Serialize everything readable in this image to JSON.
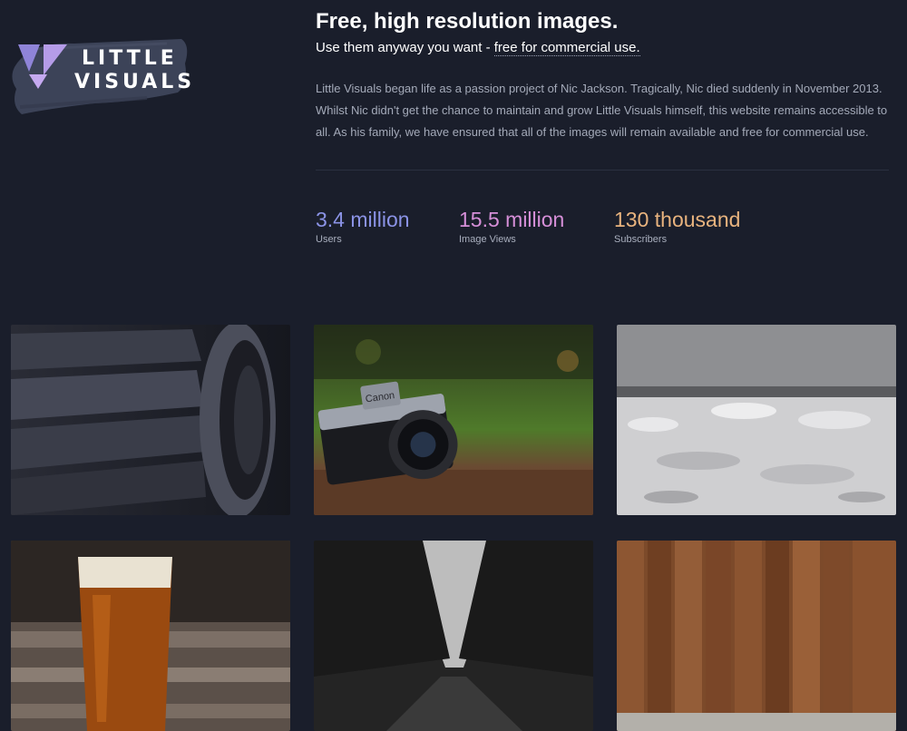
{
  "brand": {
    "line1": "LITTLE",
    "line2": "VISUALS"
  },
  "hero": {
    "headline": "Free, high resolution images.",
    "sub_prefix": "Use them anyway you want - ",
    "sub_link": "free for commercial use.",
    "bio": "Little Visuals began life as a passion project of Nic Jackson. Tragically, Nic died suddenly in November 2013. Whilst Nic didn't get the chance to maintain and grow Little Visuals himself, this website remains accessible to all. As his family, we have ensured that all of the images will remain available and free for commercial use."
  },
  "stats": [
    {
      "value": "3.4 million",
      "label": "Users",
      "color": "#8b93e6"
    },
    {
      "value": "15.5 million",
      "label": "Image Views",
      "color": "#d68fd8"
    },
    {
      "value": "130 thousand",
      "label": "Subscribers",
      "color": "#e8b37e"
    }
  ],
  "camera_brand": "Canon"
}
